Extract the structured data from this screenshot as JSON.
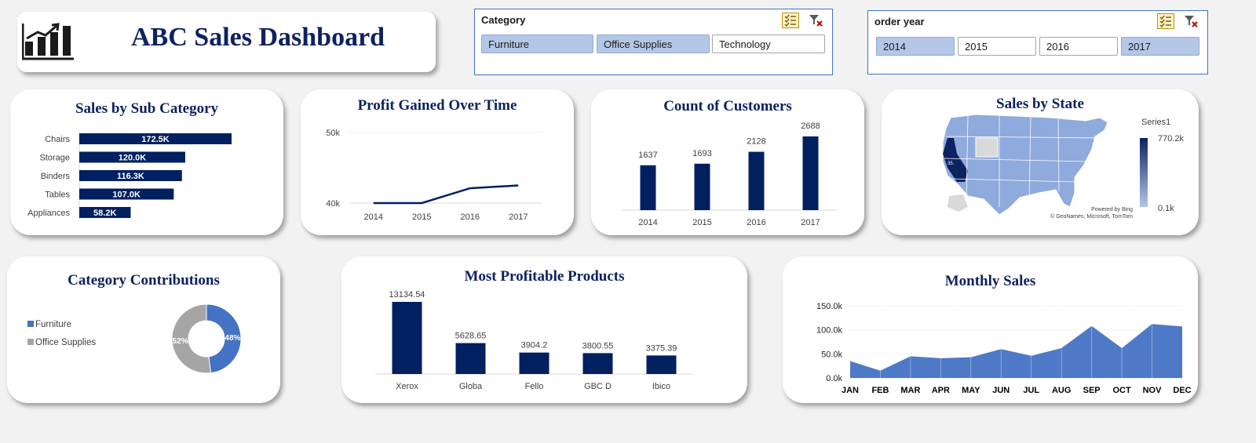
{
  "header": {
    "title": "ABC Sales Dashboard"
  },
  "slicers": {
    "category": {
      "title": "Category",
      "items": [
        {
          "label": "Furniture",
          "selected": true
        },
        {
          "label": "Office Supplies",
          "selected": true
        },
        {
          "label": "Technology",
          "selected": false
        }
      ]
    },
    "order_year": {
      "title": "order year",
      "items": [
        {
          "label": "2014",
          "selected": true
        },
        {
          "label": "2015",
          "selected": false
        },
        {
          "label": "2016",
          "selected": false
        },
        {
          "label": "2017",
          "selected": true
        }
      ]
    }
  },
  "colors": {
    "navy": "#002060",
    "accent_blue": "#4472c4",
    "slicer_selected": "#b4c7e7",
    "gray": "#a5a5a5",
    "title": "#0d2260"
  },
  "chart_data": [
    {
      "id": "sales_by_subcategory",
      "type": "bar",
      "orientation": "horizontal",
      "title": "Sales by Sub Category",
      "categories": [
        "Chairs",
        "Storage",
        "Binders",
        "Tables",
        "Appliances"
      ],
      "values": [
        172.5,
        120.0,
        116.3,
        107.0,
        58.2
      ],
      "data_labels": [
        "172.5K",
        "120.0K",
        "116.3K",
        "107.0K",
        "58.2K"
      ],
      "grid": false
    },
    {
      "id": "profit_over_time",
      "type": "line",
      "title": "Profit Gained Over Time",
      "x": [
        "2014",
        "2015",
        "2016",
        "2017"
      ],
      "y": [
        38500,
        38500,
        42100,
        42500
      ],
      "yticks": [
        "40k",
        "50k"
      ],
      "ylim": [
        40000,
        50000
      ],
      "grid": true
    },
    {
      "id": "count_of_customers",
      "type": "bar",
      "title": "Count of Customers",
      "categories": [
        "2014",
        "2015",
        "2016",
        "2017"
      ],
      "values": [
        1637,
        1693,
        2128,
        2688
      ],
      "grid": false
    },
    {
      "id": "sales_by_state",
      "type": "map",
      "title": "Sales by State",
      "legend": {
        "series": "Series1",
        "max": "770.2k",
        "min": "0.1k",
        "position": "right"
      },
      "credits": [
        "Powered by Bing",
        "© GeoNames, Microsoft, TomTom"
      ]
    },
    {
      "id": "category_contributions",
      "type": "pie",
      "variant": "doughnut",
      "title": "Category Contributions",
      "categories": [
        "Furniture",
        "Office Supplies"
      ],
      "values": [
        48,
        52
      ],
      "data_labels": [
        "48%",
        "52%"
      ],
      "legend": "left"
    },
    {
      "id": "most_profitable_products",
      "type": "bar",
      "title": "Most Profitable Products",
      "categories": [
        "Xerox",
        "Globa",
        "Fello",
        "GBC D",
        "Ibico"
      ],
      "values": [
        13134.54,
        5628.65,
        3904.2,
        3800.55,
        3375.39
      ],
      "data_labels": [
        "13134.54",
        "5628.65",
        "3904.2",
        "3800.55",
        "3375.39"
      ],
      "grid": false
    },
    {
      "id": "monthly_sales",
      "type": "area",
      "title": "Monthly Sales",
      "x": [
        "JAN",
        "FEB",
        "MAR",
        "APR",
        "MAY",
        "JUN",
        "JUL",
        "AUG",
        "SEP",
        "OCT",
        "NOV",
        "DEC"
      ],
      "y": [
        35000,
        15000,
        45000,
        41000,
        43000,
        60000,
        46000,
        62000,
        108000,
        62000,
        112000,
        107000
      ],
      "yticks": [
        "0.0k",
        "50.0k",
        "100.0k",
        "150.0k"
      ],
      "ylim": [
        0,
        150000
      ],
      "grid": true
    }
  ]
}
